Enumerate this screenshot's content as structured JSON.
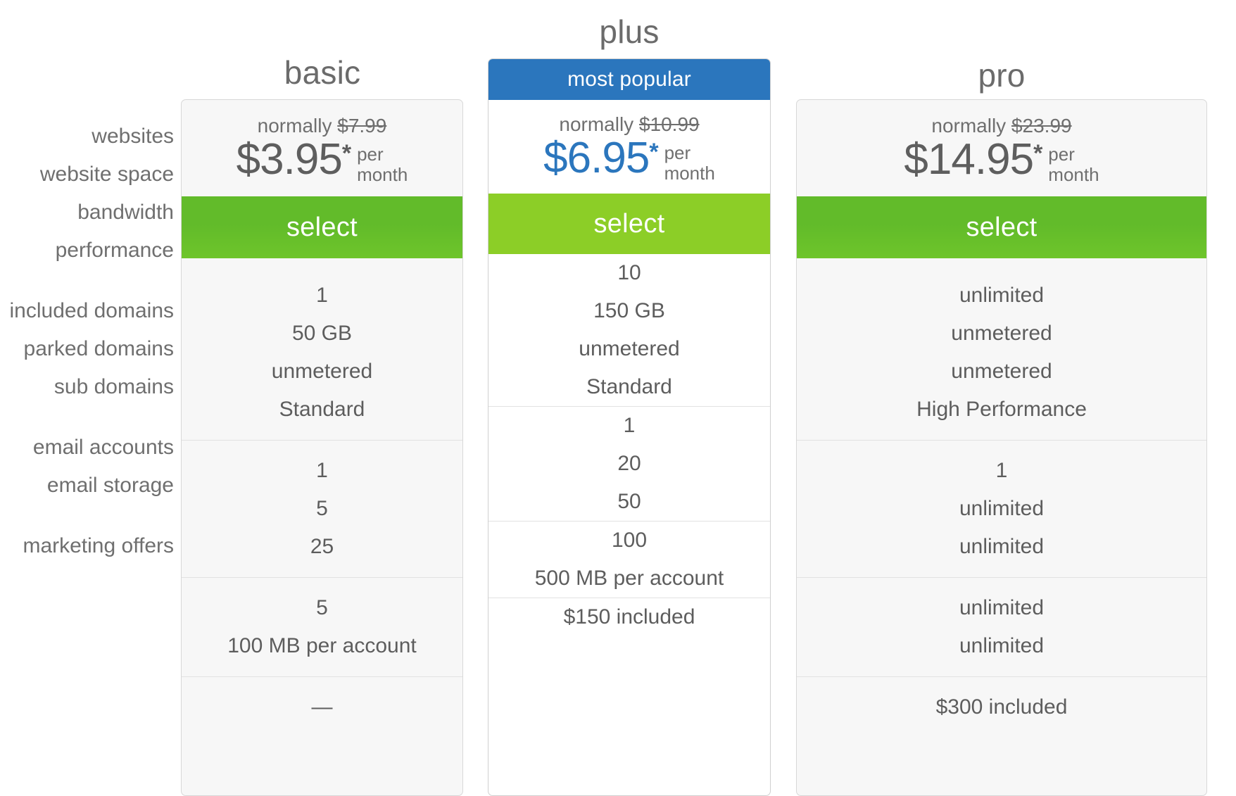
{
  "feature_labels": [
    [
      "websites",
      "website space",
      "bandwidth",
      "performance"
    ],
    [
      "included domains",
      "parked domains",
      "sub domains"
    ],
    [
      "email accounts",
      "email storage"
    ],
    [
      "marketing offers"
    ]
  ],
  "colors": {
    "accent_blue": "#2b76bd",
    "select_green_dark": "#62bb2a",
    "select_green_light": "#8cce27",
    "card_gray": "#f7f7f7",
    "card_white": "#ffffff",
    "text_gray": "#6f6f6f",
    "border": "#d8d8d8"
  },
  "plans": {
    "basic": {
      "title": "basic",
      "normally_label": "normally",
      "normally_price": "$7.99",
      "amount": "$3.95",
      "asterisk": "*",
      "per_month": "per\nmonth",
      "select_label": "select",
      "features": [
        [
          "1",
          "50 GB",
          "unmetered",
          "Standard"
        ],
        [
          "1",
          "5",
          "25"
        ],
        [
          "5",
          "100 MB per account"
        ],
        [
          "—"
        ]
      ]
    },
    "plus": {
      "title": "plus",
      "badge": "most popular",
      "normally_label": "normally",
      "normally_price": "$10.99",
      "amount": "$6.95",
      "asterisk": "*",
      "per_month": "per\nmonth",
      "select_label": "select",
      "features": [
        [
          "10",
          "150 GB",
          "unmetered",
          "Standard"
        ],
        [
          "1",
          "20",
          "50"
        ],
        [
          "100",
          "500 MB per account"
        ],
        [
          "$150 included"
        ]
      ]
    },
    "pro": {
      "title": "pro",
      "normally_label": "normally",
      "normally_price": "$23.99",
      "amount": "$14.95",
      "asterisk": "*",
      "per_month": "per\nmonth",
      "select_label": "select",
      "features": [
        [
          "unlimited",
          "unmetered",
          "unmetered",
          "High Performance"
        ],
        [
          "1",
          "unlimited",
          "unlimited"
        ],
        [
          "unlimited",
          "unlimited"
        ],
        [
          "$300 included"
        ]
      ]
    }
  }
}
